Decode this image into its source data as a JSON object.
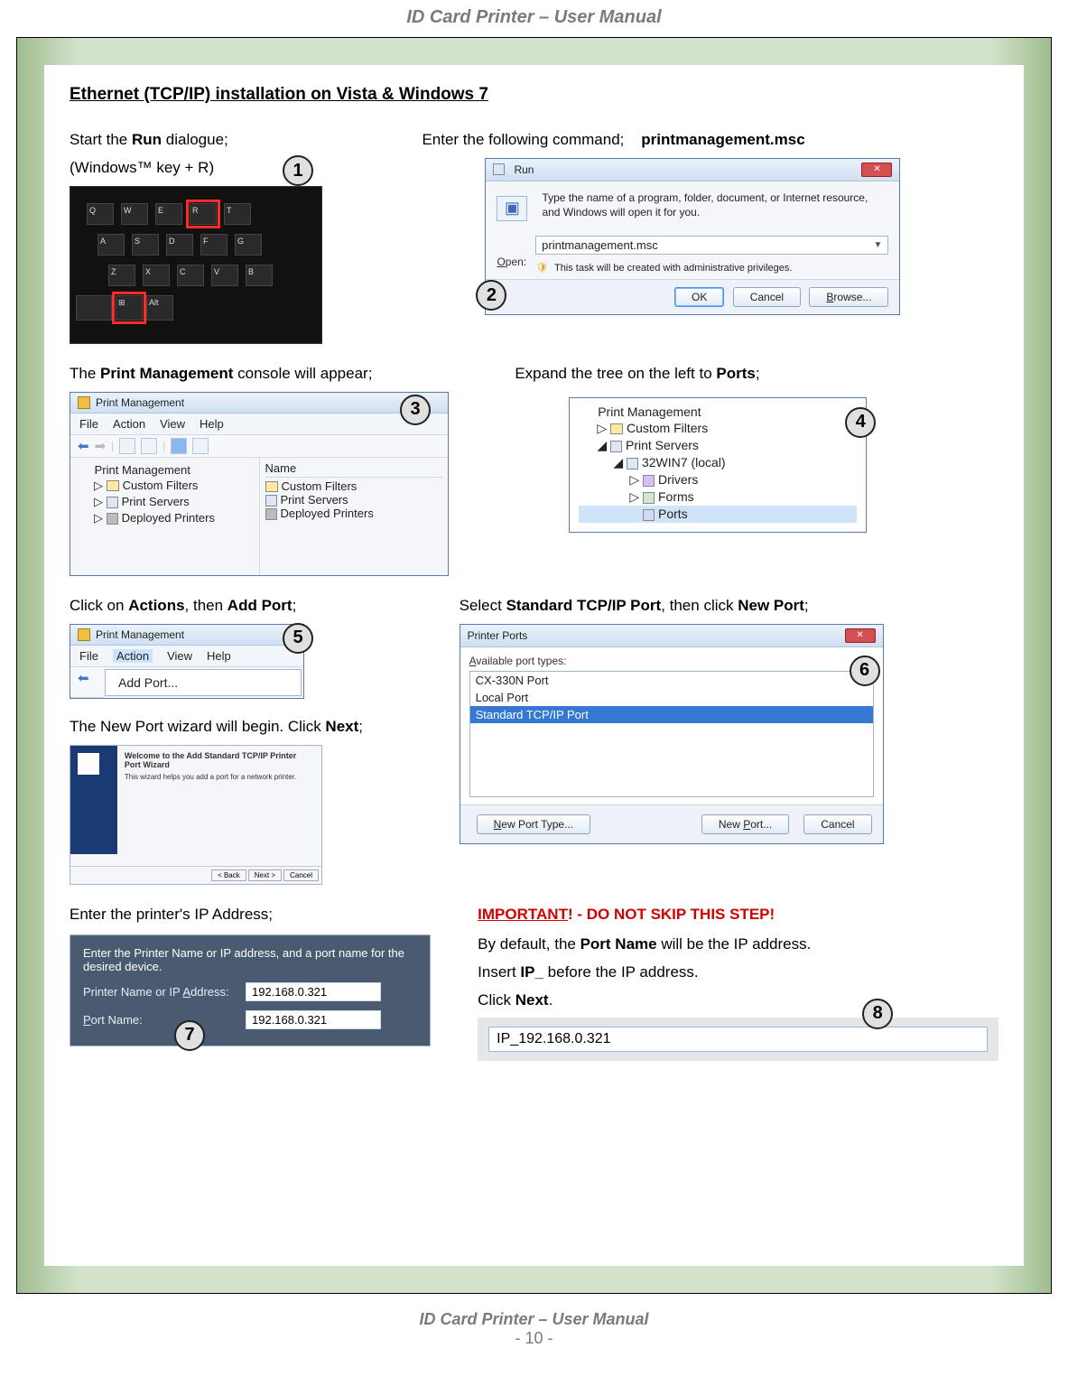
{
  "doc_title": "ID Card Printer – User Manual",
  "page_number": "- 10 -",
  "section_title": "Ethernet (TCP/IP) installation on Vista & Windows 7",
  "step1": {
    "text_a": "Start the ",
    "text_b": "Run",
    "text_c": " dialogue;",
    "subtext": "(Windows™ key + R)",
    "badge": "1"
  },
  "step2": {
    "intro": "Enter the following command;",
    "cmd": "printmanagement.msc",
    "run_title": "Run",
    "run_hint": "Type the name of a program, folder, document, or Internet resource, and Windows will open it for you.",
    "open_label": "Open:",
    "open_value": "printmanagement.msc",
    "privilege": "This task will be created with administrative privileges.",
    "btn_ok": "OK",
    "btn_cancel": "Cancel",
    "btn_browse": "Browse...",
    "badge": "2"
  },
  "step3": {
    "text_a": "The ",
    "text_b": "Print Management",
    "text_c": " console will appear;",
    "win_title": "Print Management",
    "menu": [
      "File",
      "Action",
      "View",
      "Help"
    ],
    "tree_root": "Print Management",
    "tree_items": [
      "Custom Filters",
      "Print Servers",
      "Deployed Printers"
    ],
    "col_header": "Name",
    "right_items": [
      "Custom Filters",
      "Print Servers",
      "Deployed Printers"
    ],
    "badge": "3"
  },
  "step4": {
    "text_a": "Expand the tree on the left to ",
    "text_b": "Ports",
    "text_c": ";",
    "tree_root": "Print Management",
    "tree_l1_a": "Custom Filters",
    "tree_l1_b": "Print Servers",
    "tree_l2": "32WIN7 (local)",
    "tree_l3_a": "Drivers",
    "tree_l3_b": "Forms",
    "tree_l3_c": "Ports",
    "badge": "4"
  },
  "step5": {
    "text_a": "Click on ",
    "text_b": "Actions",
    "text_c": ", then ",
    "text_d": "Add Port",
    "text_e": ";",
    "win_title": "Print Management",
    "menu": [
      "File",
      "Action",
      "View",
      "Help"
    ],
    "dropdown": "Add Port...",
    "badge": "5"
  },
  "step6": {
    "text_a": "Select ",
    "text_b": "Standard TCP/IP Port",
    "text_c": ", then click ",
    "text_d": "New Port",
    "text_e": ";",
    "dlg_title": "Printer Ports",
    "avail_label": "Available port types:",
    "ports": [
      "CX-330N Port",
      "Local Port",
      "Standard TCP/IP Port"
    ],
    "btn_newtype": "New Port Type...",
    "btn_newport": "New Port...",
    "btn_cancel": "Cancel",
    "badge": "6"
  },
  "step7": {
    "intro_a": "The New Port wizard will begin. Click ",
    "intro_b": "Next",
    "intro_c": ";",
    "wiz_title": "Welcome to the Add Standard TCP/IP Printer Port Wizard",
    "addr_intro": "Enter the printer's IP Address;",
    "addr_hd": "Enter the Printer Name or IP address, and a port name for the desired device.",
    "fld_name": "Printer Name or IP Address:",
    "fld_port": "Port Name:",
    "val_name": "192.168.0.321",
    "val_port": "192.168.0.321",
    "badge": "7"
  },
  "step8": {
    "warn_a": "IMPORTANT",
    "warn_b": "! - DO NOT SKIP THIS STEP!",
    "l1_a": "By default, the ",
    "l1_b": "Port Name",
    "l1_c": " will be the IP address.",
    "l2_a": "Insert ",
    "l2_b": "IP_",
    "l2_c": " before the IP address.",
    "l3_a": "Click ",
    "l3_b": "Next",
    "l3_c": ".",
    "port_value": "IP_192.168.0.321",
    "badge": "8"
  }
}
